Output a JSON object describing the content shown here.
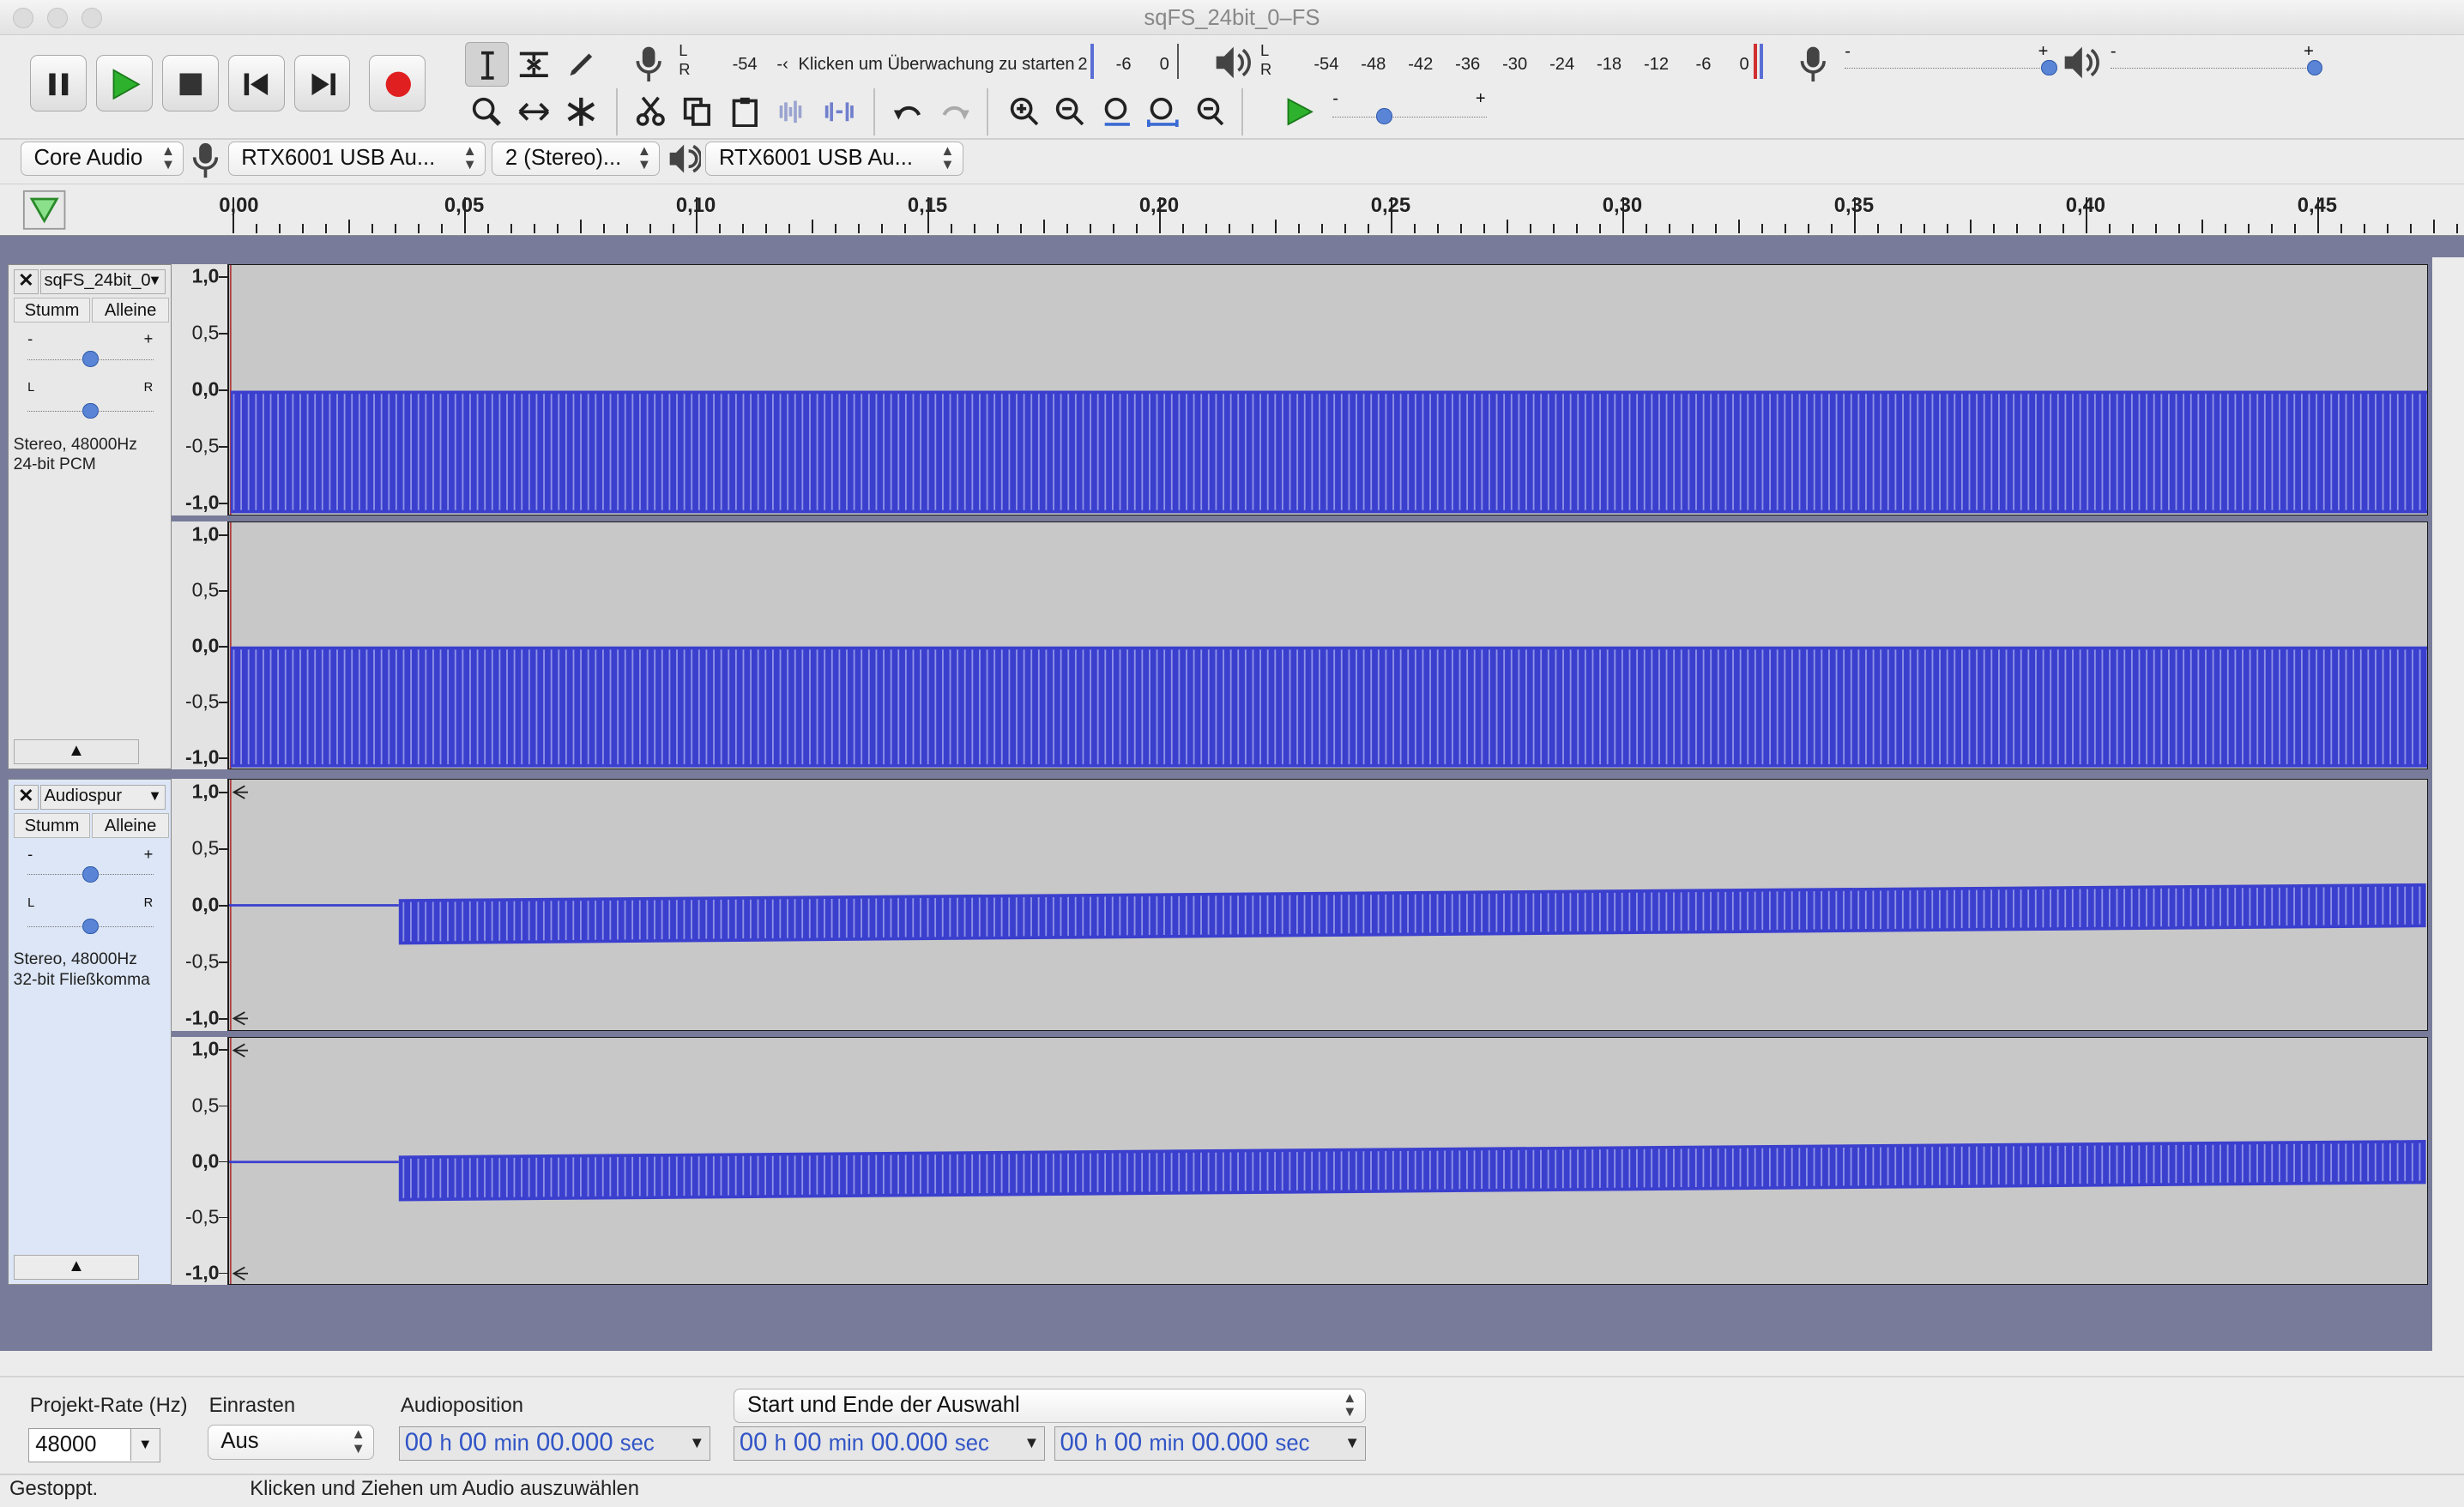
{
  "window": {
    "title": "sqFS_24bit_0–FS"
  },
  "meters": {
    "record_ticks": [
      "-54",
      "-‹",
      "2",
      "-6",
      "0"
    ],
    "record_hint": "Klicken um Überwachung zu starten",
    "play_ticks": [
      "-54",
      "-48",
      "-42",
      "-36",
      "-30",
      "-24",
      "-18",
      "-12",
      "-6",
      "0"
    ],
    "lr": {
      "l": "L",
      "r": "R"
    },
    "slider_minus": "-",
    "slider_plus": "+"
  },
  "device_bar": {
    "host": "Core Audio",
    "rec_device": "RTX6001 USB Au...",
    "channels": "2 (Stereo)...",
    "play_device": "RTX6001 USB Au..."
  },
  "ruler": {
    "labels": [
      "0,00",
      "0,05",
      "0,10",
      "0,15",
      "0,20",
      "0,25",
      "0,30",
      "0,35",
      "0,40",
      "0,45"
    ]
  },
  "amp_scale": [
    "1,0",
    "0,5",
    "0,0",
    "-0,5",
    "-1,0"
  ],
  "tracks": [
    {
      "name": "sqFS_24bit_0",
      "mute": "Stumm",
      "solo": "Alleine",
      "info1": "Stereo, 48000Hz",
      "info2": "24-bit PCM",
      "gain_minus": "-",
      "gain_plus": "+",
      "pan_l": "L",
      "pan_r": "R"
    },
    {
      "name": "Audiospur",
      "mute": "Stumm",
      "solo": "Alleine",
      "info1": "Stereo, 48000Hz",
      "info2": "32-bit Fließkomma",
      "gain_minus": "-",
      "gain_plus": "+",
      "pan_l": "L",
      "pan_r": "R"
    }
  ],
  "selection_bar": {
    "rate_label": "Projekt-Rate (Hz)",
    "rate_value": "48000",
    "snap_label": "Einrasten",
    "snap_value": "Aus",
    "pos_label": "Audioposition",
    "sel_mode": "Start und Ende der Auswahl",
    "time": {
      "h": "00",
      "hu": "h",
      "m": "00",
      "mu": "min",
      "s": "00.000",
      "su": "sec"
    }
  },
  "status": {
    "left": "Gestoppt.",
    "right": "Klicken und Ziehen um Audio auszuwählen"
  },
  "colors": {
    "wave": "#3b3fce",
    "wave_bg": "#c8c8c8",
    "track_bg": "#787c9a",
    "time_text": "#3155c6"
  }
}
